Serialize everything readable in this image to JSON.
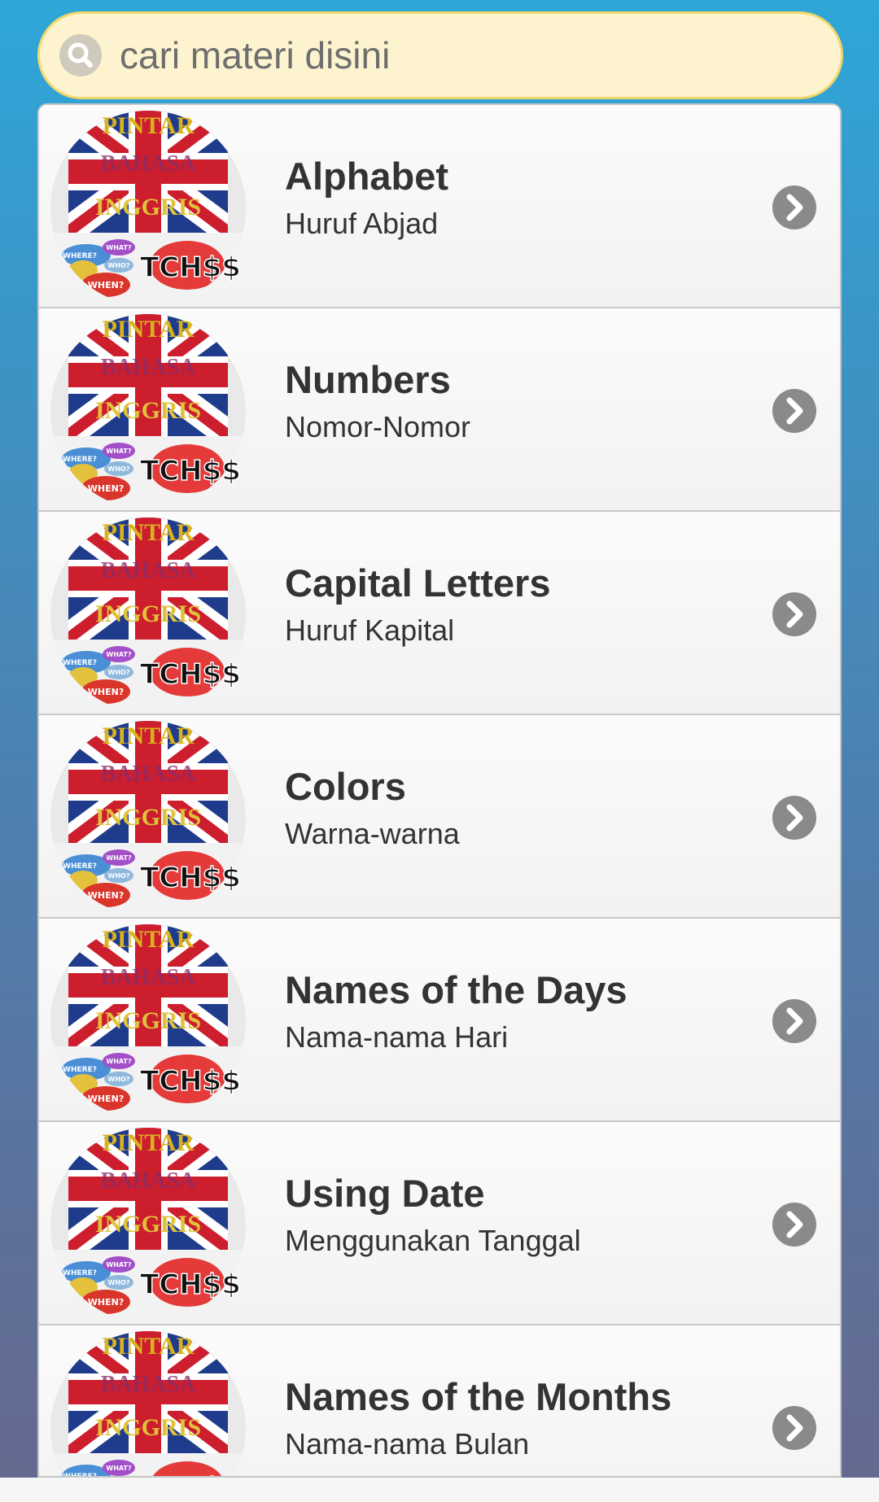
{
  "search": {
    "placeholder": "cari materi disini",
    "icon": "search-icon"
  },
  "thumbnail": {
    "logo_text": {
      "top": "PINTAR",
      "middle": "BAHASA",
      "bottom": "INGGRIS",
      "bubble_1": "WHERE?",
      "bubble_2": "WHAT?",
      "bubble_3": "WHO?",
      "bubble_4": "WHEN?",
      "sticker": "TCH$$"
    }
  },
  "list": {
    "items": [
      {
        "title": "Alphabet",
        "subtitle": "Huruf Abjad"
      },
      {
        "title": "Numbers",
        "subtitle": "Nomor-Nomor"
      },
      {
        "title": "Capital Letters",
        "subtitle": "Huruf Kapital"
      },
      {
        "title": "Colors",
        "subtitle": "Warna-warna"
      },
      {
        "title": "Names of the Days",
        "subtitle": "Nama-nama Hari"
      },
      {
        "title": "Using Date",
        "subtitle": "Menggunakan Tanggal"
      },
      {
        "title": "Names of the Months",
        "subtitle": "Nama-nama Bulan"
      }
    ]
  },
  "colors": {
    "search_bg": "#fdf4cf",
    "search_border": "#f1d76a",
    "chevron": "#8a8a8a",
    "text": "#333333"
  }
}
